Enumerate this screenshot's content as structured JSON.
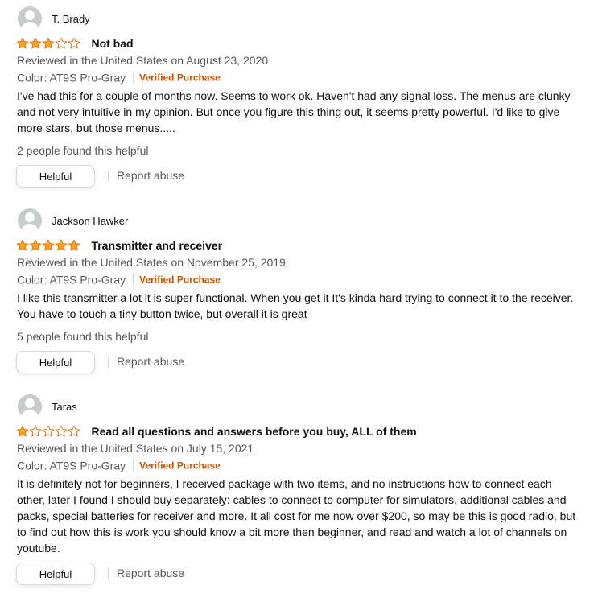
{
  "colors": {
    "star_fill": "#ffa41c",
    "star_outline": "#de7921",
    "verified": "#c45500",
    "muted_text": "#565959",
    "text": "#0f1111"
  },
  "reviews": [
    {
      "name": "T. Brady",
      "rating": 3,
      "rating_max": 5,
      "title": "Not bad",
      "date_line": "Reviewed in the United States on August 23, 2020",
      "color_label": "Color: AT9S Pro-Gray",
      "verified_label": "Verified Purchase",
      "body": "I've had this for a couple of months now. Seems to work ok. Haven't had any signal loss. The menus are clunky and not very intuitive in my opinion. But once you figure this thing out, it seems pretty powerful. I'd like to give more stars, but those menus.....",
      "helpful_count": "2 people found this helpful",
      "helpful_button": "Helpful",
      "report_label": "Report abuse"
    },
    {
      "name": "Jackson Hawker",
      "rating": 5,
      "rating_max": 5,
      "title": "Transmitter and receiver",
      "date_line": "Reviewed in the United States on November 25, 2019",
      "color_label": "Color: AT9S Pro-Gray",
      "verified_label": "Verified Purchase",
      "body": "I like this transmitter a lot it is super functional. When you get it It's kinda hard trying to connect it to the receiver. You have to touch a tiny button twice, but overall it is great",
      "helpful_count": "5 people found this helpful",
      "helpful_button": "Helpful",
      "report_label": "Report abuse"
    },
    {
      "name": "Taras",
      "rating": 1,
      "rating_max": 5,
      "title": "Read all questions and answers before you buy, ALL of them",
      "date_line": "Reviewed in the United States on July 15, 2021",
      "color_label": "Color: AT9S Pro-Gray",
      "verified_label": "Verified Purchase",
      "body": "It is definitely not for beginners, I received package with two items, and no instructions how to connect each other, later I found I should buy separately: cables to connect to computer for simulators, additional cables and packs, special batteries for receiver and more. It all cost for me now over $200, so may be this is good radio, but to find out how this is work you should know a bit more then beginner, and read and watch a lot of channels on youtube.",
      "helpful_button": "Helpful",
      "report_label": "Report abuse"
    }
  ]
}
